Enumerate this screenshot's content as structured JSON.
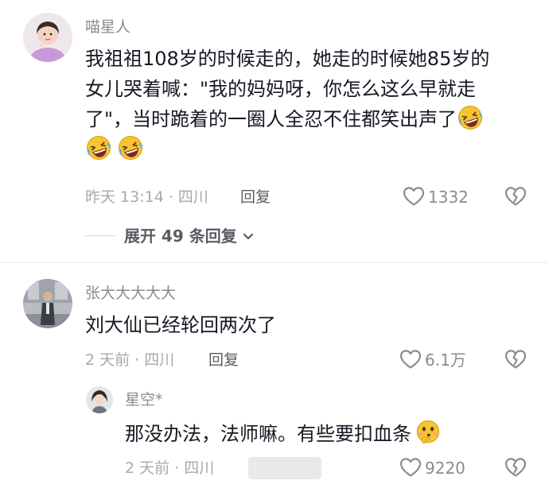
{
  "comments": [
    {
      "username": "喵星人",
      "text_line1": "我祖祖108岁的时候走的，她走的时候她85岁的",
      "text_line2": "女儿哭着喊：\"我的妈妈呀，你怎么这么早就走",
      "text_line3": "了\"，当时跪着的一圈人全忍不住都笑出声了",
      "meta": "昨天 13:14 · 四川",
      "reply_label": "回复",
      "likes": "1332",
      "expand_label": "展开 49 条回复"
    },
    {
      "username": "张大大大大大",
      "text": "刘大仙已经轮回两次了",
      "meta": "2 天前 · 四川",
      "reply_label": "回复",
      "likes": "6.1万"
    },
    {
      "username": "星空*",
      "text": "那没办法，法师嘛。有些要扣血条",
      "meta": "2 天前 · 四川",
      "likes": "9220"
    }
  ],
  "icons": {
    "like": "heart-outline-icon",
    "dislike": "broken-heart-icon",
    "laugh": "rolling-laughing-emoji",
    "think": "thinking-emoji",
    "expand": "chevron-down-icon"
  },
  "colors": {
    "text": "#161823",
    "username": "#8a8b91",
    "meta": "#a7a8ad",
    "emoji_yellow": "#f7c531"
  }
}
